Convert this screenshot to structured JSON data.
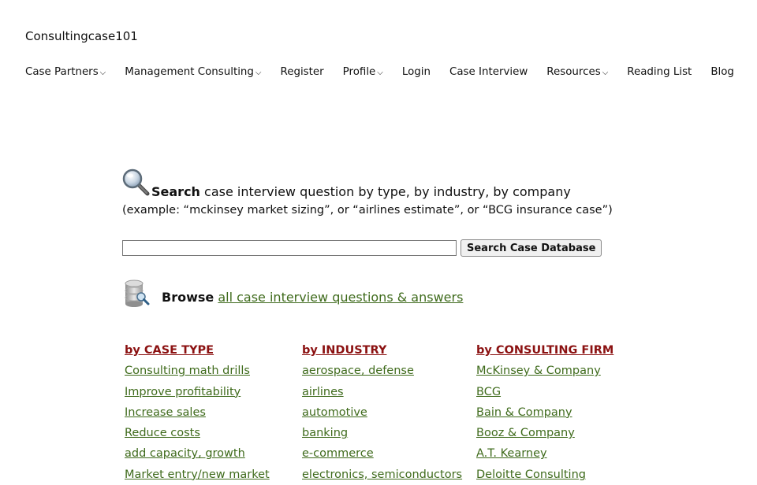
{
  "site": {
    "title": "Consultingcase101"
  },
  "nav": {
    "items": [
      {
        "label": "Case Partners",
        "dropdown": true
      },
      {
        "label": "Management Consulting",
        "dropdown": true
      },
      {
        "label": "Register",
        "dropdown": false
      },
      {
        "label": "Profile",
        "dropdown": true
      },
      {
        "label": "Login",
        "dropdown": false
      },
      {
        "label": "Case Interview",
        "dropdown": false
      },
      {
        "label": "Resources",
        "dropdown": true
      },
      {
        "label": "Reading List",
        "dropdown": false
      },
      {
        "label": "Blog",
        "dropdown": false
      }
    ],
    "caret": "⌵"
  },
  "search": {
    "bold": "Search",
    "text": " case interview question by type, by industry, by company",
    "example": "(example: “mckinsey market sizing”, or “airlines estimate”, or “BCG insurance case”)",
    "input_value": "",
    "button_label": "Search Case Database",
    "icon": "magnifier-icon"
  },
  "browse": {
    "bold": "Browse",
    "link": "all case interview questions & answers",
    "icon": "database-search-icon"
  },
  "columns": [
    {
      "heading": "by CASE TYPE",
      "links": [
        "Consulting math drills",
        "Improve profitability",
        "Increase sales",
        "Reduce costs",
        "add capacity, growth",
        "Market entry/new market"
      ]
    },
    {
      "heading": "by INDUSTRY",
      "links": [
        "aerospace, defense",
        "airlines",
        "automotive",
        "banking",
        "e-commerce",
        "electronics, semiconductors"
      ]
    },
    {
      "heading": "by CONSULTING FIRM",
      "links": [
        "McKinsey & Company",
        "BCG",
        "Bain & Company",
        "Booz & Company",
        "A.T. Kearney",
        "Deloitte Consulting"
      ]
    }
  ],
  "colors": {
    "link": "#3f6b1c",
    "heading": "#8b1111"
  }
}
